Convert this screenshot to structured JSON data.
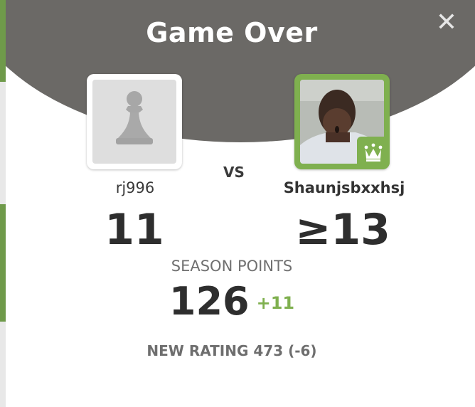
{
  "modal": {
    "title": "Game Over",
    "close_icon": "close-icon",
    "vs_label": "VS"
  },
  "players": {
    "left": {
      "username": "rj996",
      "score": "11",
      "avatar_icon": "pawn-icon"
    },
    "right": {
      "username": "Shaunjsbxxhsj",
      "score": "≥13",
      "badge_icon": "crown-icon"
    }
  },
  "season": {
    "label": "SEASON POINTS",
    "points": "126",
    "delta": "+11"
  },
  "rating": {
    "text": "NEW RATING 473 (-6)"
  },
  "colors": {
    "header": "#6b6966",
    "accent_green": "#7fb04f",
    "text_dark": "#2e2e2e",
    "text_muted": "#707070"
  }
}
